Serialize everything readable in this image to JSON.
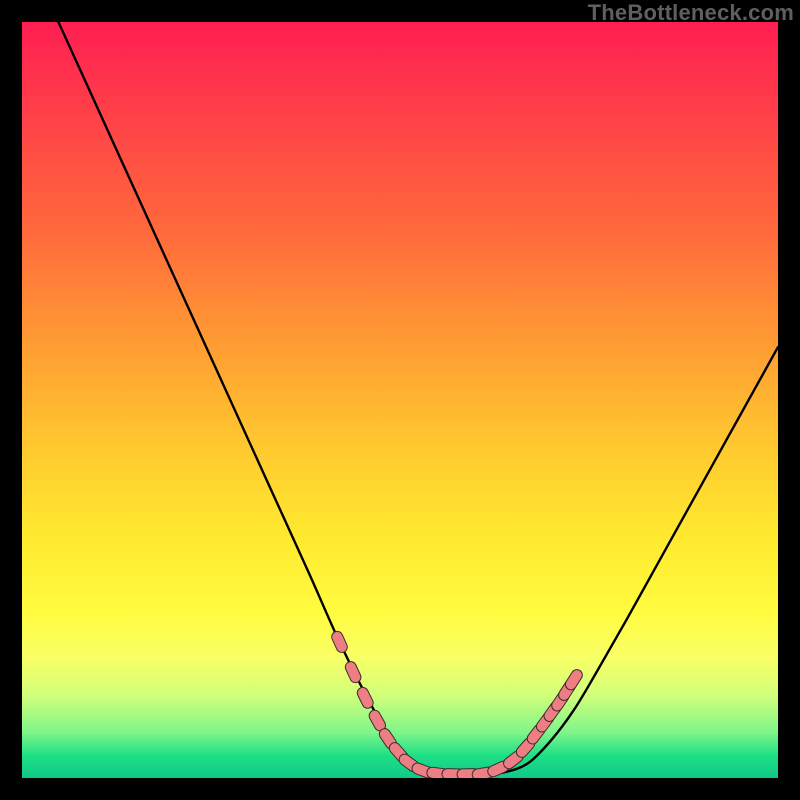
{
  "watermark": "TheBottleneck.com",
  "colors": {
    "frame": "#000000",
    "curve_stroke": "#000000",
    "marker_fill": "#ed7e83",
    "marker_stroke": "#3a2d2d"
  },
  "chart_data": {
    "type": "line",
    "title": "",
    "xlabel": "",
    "ylabel": "",
    "xlim": [
      0,
      100
    ],
    "ylim": [
      0,
      100
    ],
    "grid": false,
    "legend": false,
    "series": [
      {
        "name": "bottleneck-curve",
        "x": [
          3,
          8,
          13,
          18,
          23,
          28,
          33,
          38,
          42,
          46,
          49,
          52,
          55,
          58,
          61,
          64,
          67,
          70,
          73,
          76,
          80,
          85,
          90,
          95,
          100
        ],
        "y": [
          104,
          93,
          82,
          71,
          60,
          49,
          38,
          27,
          18,
          10,
          5,
          2,
          0.8,
          0.5,
          0.5,
          0.8,
          2,
          5,
          9,
          14,
          21,
          30,
          39,
          48,
          57
        ]
      }
    ],
    "markers": {
      "name": "highlight-dots",
      "x": [
        42.0,
        43.8,
        45.4,
        47.0,
        48.4,
        49.8,
        51.2,
        53.0,
        55.0,
        57.0,
        59.0,
        61.0,
        63.0,
        65.0,
        66.6,
        68.0,
        69.2,
        70.2,
        71.2,
        72.1,
        73.0
      ],
      "y": [
        18.0,
        14.0,
        10.6,
        7.6,
        5.2,
        3.4,
        2.0,
        1.0,
        0.6,
        0.5,
        0.5,
        0.6,
        1.2,
        2.4,
        4.0,
        5.8,
        7.4,
        8.8,
        10.2,
        11.6,
        13.0
      ]
    }
  }
}
